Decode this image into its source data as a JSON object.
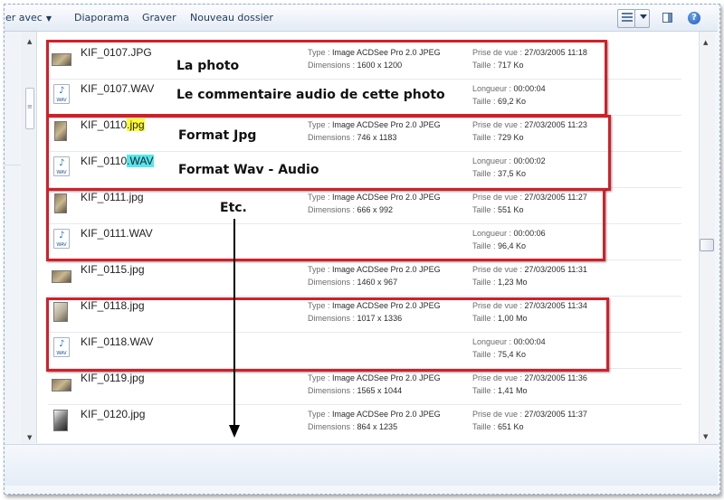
{
  "toolbar": {
    "open_with": "er avec",
    "slideshow": "Diaporama",
    "burn": "Graver",
    "new_folder": "Nouveau dossier"
  },
  "icons": {
    "view": "view-details-icon",
    "view_menu": "chevron-down-icon",
    "preview_pane": "preview-pane-icon",
    "help": "help-icon",
    "help_glyph": "?"
  },
  "labels": {
    "type": "Type : ",
    "dimensions": "Dimensions : ",
    "taken": "Prise de vue : ",
    "size": "Taille : ",
    "length": "Longueur : "
  },
  "files": [
    {
      "name": "KIF_0107.JPG",
      "type": "Image ACDSee Pro 2.0 JPEG",
      "dimensions": "1600 x 1200",
      "taken": "27/03/2005 11:18",
      "size": "717 Ko"
    },
    {
      "name": "KIF_0107.WAV",
      "length": "00:00:04",
      "size": "69,2 Ko"
    },
    {
      "name_base": "KIF_0110",
      "name_ext": ".jpg",
      "type": "Image ACDSee Pro 2.0 JPEG",
      "dimensions": "746 x 1183",
      "taken": "27/03/2005 11:23",
      "size": "729 Ko"
    },
    {
      "name_base": "KIF_0110",
      "name_ext": ".WAV",
      "length": "00:00:02",
      "size": "37,5 Ko"
    },
    {
      "name": "KIF_0111.jpg",
      "type": "Image ACDSee Pro 2.0 JPEG",
      "dimensions": "666 x 992",
      "taken": "27/03/2005 11:27",
      "size": "551 Ko"
    },
    {
      "name": "KIF_0111.WAV",
      "length": "00:00:06",
      "size": "96,4 Ko"
    },
    {
      "name": "KIF_0115.jpg",
      "type": "Image ACDSee Pro 2.0 JPEG",
      "dimensions": "1460 x 967",
      "taken": "27/03/2005 11:31",
      "size": "1,23 Mo"
    },
    {
      "name": "KIF_0118.jpg",
      "type": "Image ACDSee Pro 2.0 JPEG",
      "dimensions": "1017 x 1336",
      "taken": "27/03/2005 11:34",
      "size": "1,00 Mo"
    },
    {
      "name": "KIF_0118.WAV",
      "length": "00:00:04",
      "size": "75,4 Ko"
    },
    {
      "name": "KIF_0119.jpg",
      "type": "Image ACDSee Pro 2.0 JPEG",
      "dimensions": "1565 x 1044",
      "taken": "27/03/2005 11:36",
      "size": "1,41 Mo"
    },
    {
      "name": "KIF_0120.jpg",
      "type": "Image ACDSee Pro 2.0 JPEG",
      "dimensions": "864 x 1235",
      "taken": "27/03/2005 11:37",
      "size": "651 Ko"
    }
  ],
  "wav_badge": "WAV",
  "annotations": {
    "photo": "La photo",
    "audio_comment": "Le commentaire audio de cette photo",
    "format_jpg": "Format Jpg",
    "format_wav": "Format Wav - Audio",
    "etc": "Etc."
  },
  "colors": {
    "annotation_box": "#d41f28",
    "highlight_jpg": "#ffff33",
    "highlight_wav": "#55e6f0"
  }
}
